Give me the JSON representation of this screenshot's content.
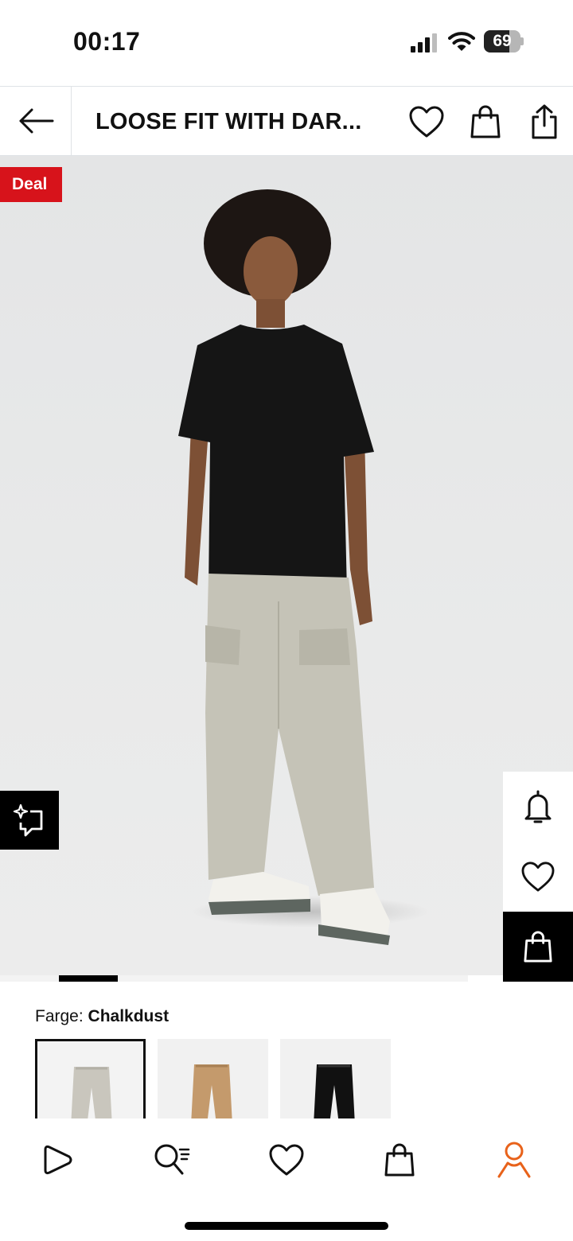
{
  "status_bar": {
    "time": "00:17",
    "battery": "69",
    "battery_level": 0.69,
    "icons": [
      "signal-icon",
      "wifi-icon",
      "battery-icon"
    ]
  },
  "header": {
    "title": "LOOSE FIT WITH DAR...",
    "icons": [
      "back-arrow-icon",
      "heart-icon",
      "shopping-bag-icon",
      "share-icon"
    ]
  },
  "product": {
    "badge": "Deal",
    "badge_color": "#d7131b",
    "image_icon_names": [
      "ar-try-on-icon",
      "bell-icon",
      "heart-icon",
      "shopping-bag-icon"
    ]
  },
  "carousel": {
    "active_index": 1
  },
  "color": {
    "label": "Farge:",
    "selected": "Chalkdust",
    "swatch_colors": [
      "#c9c6bd",
      "#c49a6c",
      "#111111"
    ]
  },
  "bottom_nav": {
    "items": [
      "home-icon",
      "search-list-icon",
      "wishlist-icon",
      "cart-icon",
      "profile-icon"
    ],
    "accent": "#e8621a"
  }
}
